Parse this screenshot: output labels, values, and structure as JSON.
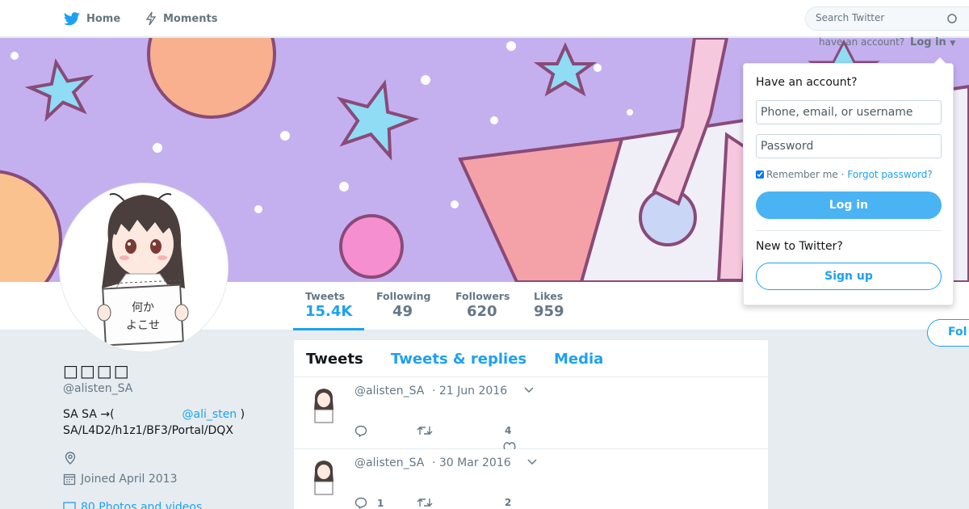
{
  "nav": {
    "home_label": "Home",
    "moments_label": "Moments",
    "search_placeholder": "Search Twitter"
  },
  "login_prompt": {
    "text": "have an account?",
    "link": "Log in"
  },
  "login_menu": {
    "title": "Have an account?",
    "username_placeholder": "Phone, email, or username",
    "password_placeholder": "Password",
    "remember_label": "Remember me ·",
    "forgot_label": "Forgot password?",
    "login_button": "Log in",
    "new_title": "New to Twitter?",
    "signup_button": "Sign up"
  },
  "stats": [
    {
      "label": "Tweets",
      "value": "15.4K"
    },
    {
      "label": "Following",
      "value": "49"
    },
    {
      "label": "Followers",
      "value": "620"
    },
    {
      "label": "Likes",
      "value": "959"
    }
  ],
  "follow_button": "Fol",
  "profile": {
    "name": "□□□□",
    "handle": "@alisten_SA",
    "bio_line1": "SA SA →(",
    "bio_link": "@ali_sten",
    "bio_close": " )",
    "bio_line2": "SA/L4D2/h1z1/BF3/Portal/DQX",
    "joined": "Joined April 2013",
    "photos": "80 Photos and videos",
    "avatar_sign_text": "何か\nよこせ"
  },
  "timeline": {
    "tabs": [
      "Tweets",
      "Tweets & replies",
      "Media"
    ],
    "tweets": [
      {
        "handle": "@alisten_SA",
        "date": "· 21 Jun 2016",
        "replies": "",
        "retweets": "",
        "likes": "4"
      },
      {
        "handle": "@alisten_SA",
        "date": "· 30 Mar 2016",
        "replies": "1",
        "retweets": "",
        "likes": "2"
      }
    ]
  },
  "colors": {
    "accent": "#1da1f2",
    "banner": "#c4b0ef",
    "background": "#e6ecf0"
  }
}
